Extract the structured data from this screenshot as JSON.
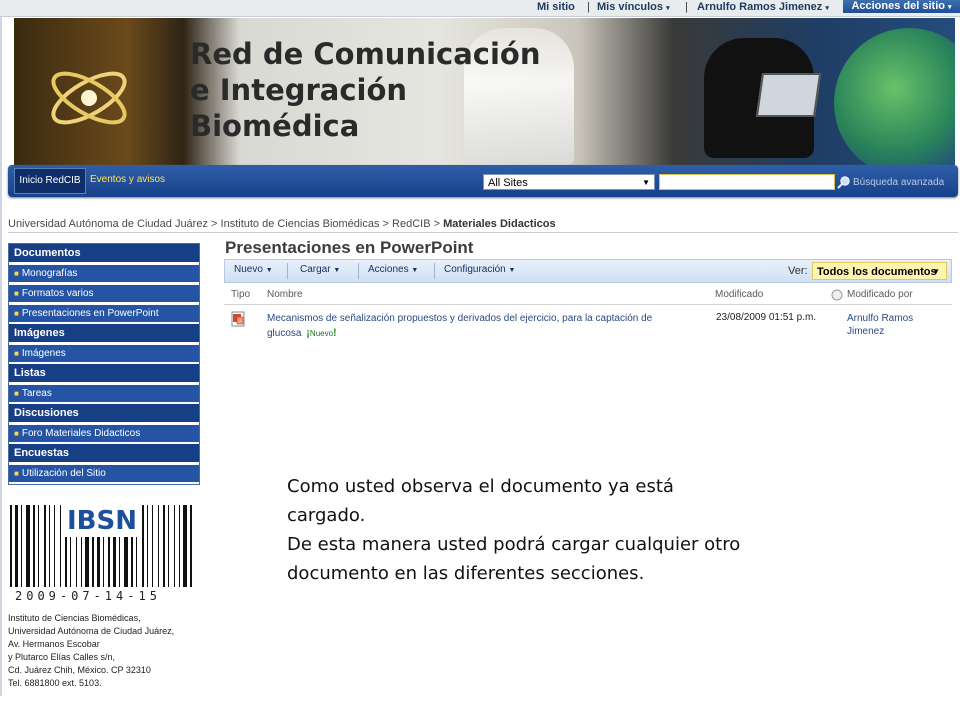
{
  "topbar": {
    "my_site": "Mi sitio",
    "my_links": "Mis vínculos",
    "user": "Arnulfo Ramos Jimenez",
    "site_actions": "Acciones del sitio"
  },
  "banner": {
    "title_line1": "Red de Comunicación",
    "title_line2": "e Integración",
    "title_line3": "Biomédica"
  },
  "nav": {
    "home": "Inicio RedCIB",
    "events": "Eventos y avisos",
    "scope": "All Sites",
    "search_value": "",
    "advanced_search": "Búsqueda avanzada"
  },
  "breadcrumb": {
    "parts": [
      "Universidad Autónoma de Ciudad Juárez",
      "Instituto de Ciencias Biomédicas",
      "RedCIB"
    ],
    "current": "Materiales Didacticos",
    "separator": " > "
  },
  "sidebar": {
    "sections": [
      {
        "heading": "Documentos",
        "items": [
          "Monografías",
          "Formatos varios",
          "Presentaciones en PowerPoint"
        ]
      },
      {
        "heading": "Imágenes",
        "items": [
          "Imágenes"
        ]
      },
      {
        "heading": "Listas",
        "items": [
          "Tareas"
        ]
      },
      {
        "heading": "Discusiones",
        "items": [
          "Foro Materiales Didacticos"
        ]
      },
      {
        "heading": "Encuestas",
        "items": [
          "Utilización del Sitio"
        ]
      }
    ]
  },
  "main": {
    "title": "Presentaciones en PowerPoint",
    "toolbar": {
      "new": "Nuevo",
      "upload": "Cargar",
      "actions": "Acciones",
      "settings": "Configuración",
      "view_label": "Ver:",
      "view_value": "Todos los documentos"
    },
    "columns": {
      "type": "Tipo",
      "name": "Nombre",
      "modified": "Modificado",
      "modified_by": "Modificado por"
    },
    "rows": [
      {
        "name": "Mecanismos de señalización propuestos y derivados del ejercicio, para la captación de glucosa",
        "badge": "Nuevo",
        "modified": "23/08/2009 01:51 p.m.",
        "modified_by": "Arnulfo Ramos Jimenez"
      }
    ]
  },
  "note": {
    "line1": "Como usted observa el documento ya está cargado.",
    "line2": "De esta manera usted podrá cargar cualquier otro documento en las diferentes secciones."
  },
  "footer": {
    "logo_text": "IBSN",
    "barcode_number": "2009-07-14-15",
    "address_lines": [
      "Instituto de Ciencias Biomédicas,",
      "Universidad Autónoma de Ciudad Juárez,",
      "Av. Hermanos Escobar",
      "y Plutarco Elías Calles s/n,",
      "Cd. Juárez Chih, México. CP 32310",
      "Tel. 6881800 ext. 5103."
    ]
  },
  "colors": {
    "nav_blue": "#2454a3",
    "nav_dark": "#173f86",
    "link_blue": "#2a4a83",
    "view_highlight": "#fff3b0"
  }
}
